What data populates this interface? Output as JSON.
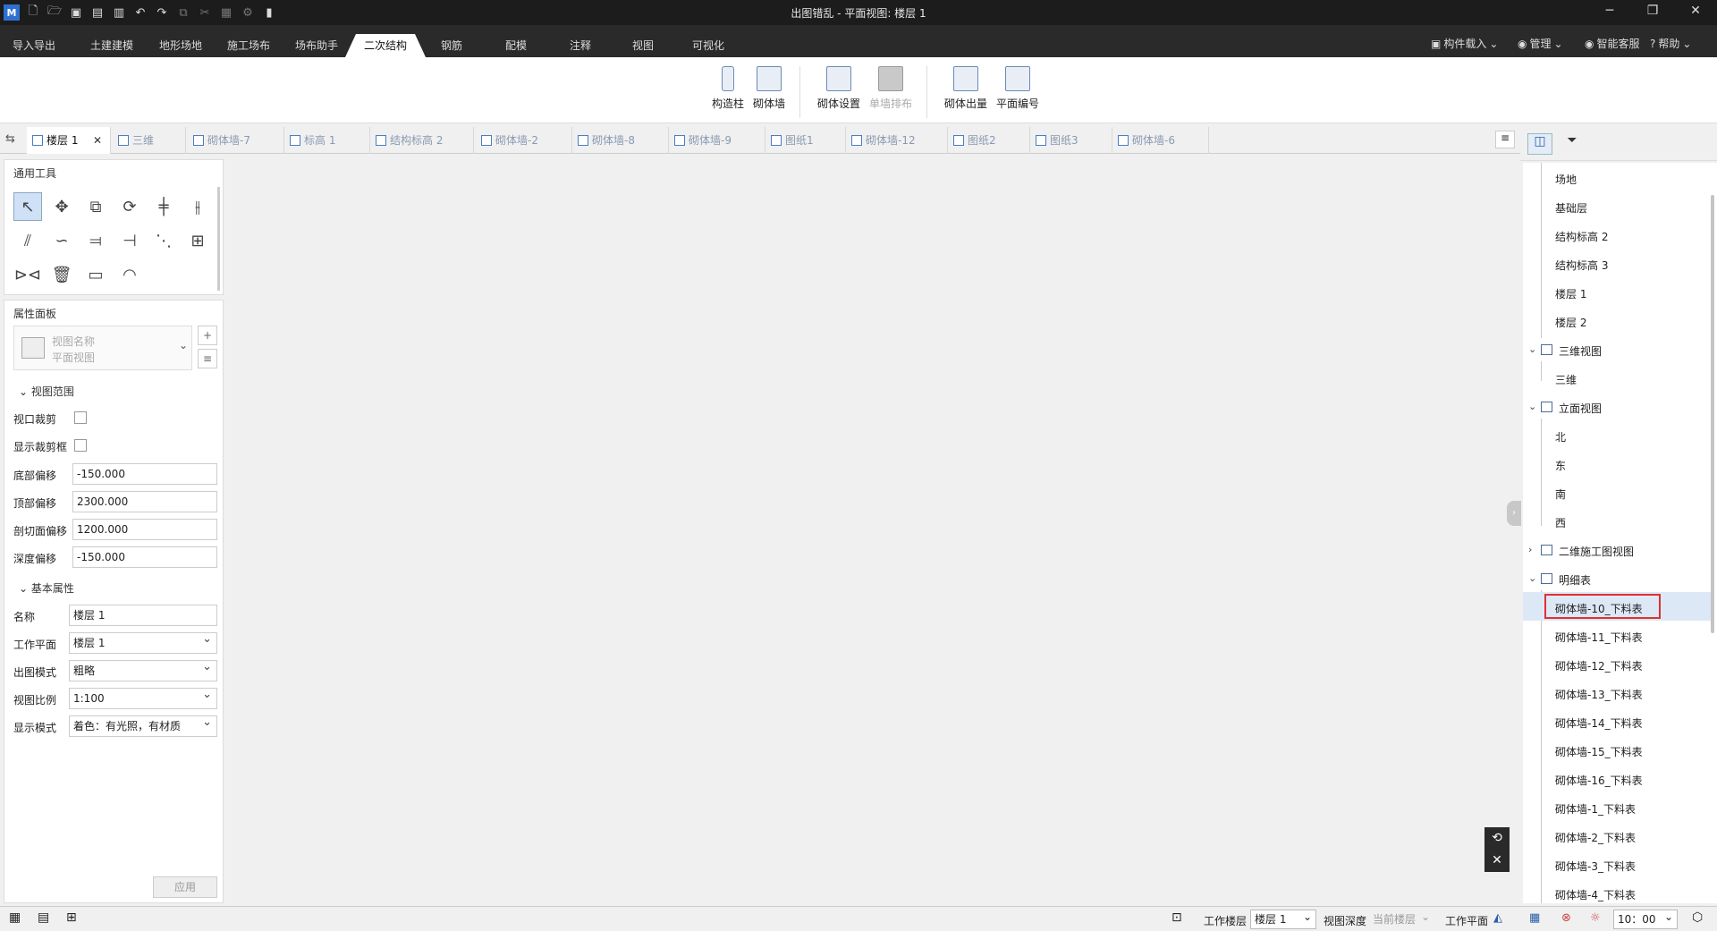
{
  "titlebar": {
    "title": "出图错乱 - 平面视图: 楼层 1"
  },
  "menubar": {
    "tabs": [
      "导入导出",
      "土建建模",
      "地形场地",
      "施工场布",
      "场布助手",
      "二次结构",
      "钢筋",
      "配模",
      "注释",
      "视图",
      "可视化"
    ],
    "active_tab": "二次结构",
    "right": [
      "构件载入",
      "管理",
      "智能客服",
      "帮助"
    ]
  },
  "ribbon": {
    "buttons": [
      "构造柱",
      "砌体墙",
      "砌体设置",
      "单墙排布",
      "砌体出量",
      "平面编号"
    ]
  },
  "view_tabs": [
    "楼层 1",
    "三维",
    "砌体墙-7",
    "标高 1",
    "结构标高 2",
    "砌体墙-2",
    "砌体墙-8",
    "砌体墙-9",
    "图纸1",
    "砌体墙-12",
    "图纸2",
    "图纸3",
    "砌体墙-6"
  ],
  "tools_panel": {
    "title": "通用工具"
  },
  "props": {
    "title": "属性面板",
    "view_name_placeholder": "视图名称",
    "view_type": "平面视图",
    "section_view_range": "视图范围",
    "viewport_crop": "视口裁剪",
    "show_crop": "显示裁剪框",
    "bottom_offset_label": "底部偏移",
    "bottom_offset": "-150.000",
    "top_offset_label": "顶部偏移",
    "top_offset": "2300.000",
    "cut_offset_label": "剖切面偏移",
    "cut_offset": "1200.000",
    "depth_offset_label": "深度偏移",
    "depth_offset": "-150.000",
    "section_basic": "基本属性",
    "name_label": "名称",
    "name": "楼层 1",
    "workplane_label": "工作平面",
    "workplane": "楼层 1",
    "output_mode_label": "出图模式",
    "output_mode": "粗略",
    "scale_label": "视图比例",
    "scale": "1:100",
    "display_mode_label": "显示模式",
    "display_mode": "着色：有光照，有材质",
    "apply": "应用"
  },
  "tree": {
    "items_top": [
      "场地",
      "基础层",
      "结构标高 2",
      "结构标高 3",
      "楼层 1",
      "楼层 2"
    ],
    "group_3d": "三维视图",
    "item_3d": "三维",
    "group_elev": "立面视图",
    "elev_items": [
      "北",
      "东",
      "南",
      "西"
    ],
    "group_2d": "二维施工图视图",
    "group_sched": "明细表",
    "sched_items": [
      "砌体墙-10_下料表",
      "砌体墙-11_下料表",
      "砌体墙-12_下料表",
      "砌体墙-13_下料表",
      "砌体墙-14_下料表",
      "砌体墙-15_下料表",
      "砌体墙-16_下料表",
      "砌体墙-1_下料表",
      "砌体墙-2_下料表",
      "砌体墙-3_下料表",
      "砌体墙-4_下料表"
    ],
    "highlight": "砌体墙-10_下料表",
    "highlight_color": "#e03030"
  },
  "statusbar": {
    "work_floor_label": "工作楼层",
    "work_floor": "楼层 1",
    "view_depth_label": "视图深度",
    "view_depth": "当前楼层",
    "workplane_label": "工作平面",
    "time": "10：00"
  }
}
